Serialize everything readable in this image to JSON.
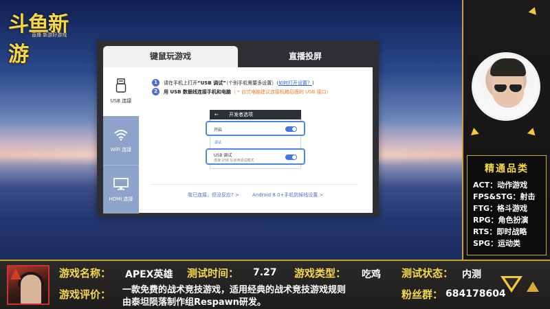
{
  "logo": {
    "title": "斗鱼新游",
    "subtitle": "直播 新游好游戏"
  },
  "dialog": {
    "tabs": [
      {
        "label": "键鼠玩游戏"
      },
      {
        "label": "直播投屏"
      }
    ],
    "sidebar": [
      {
        "label": "USB 连接",
        "icon": "usb-icon"
      },
      {
        "label": "WiFi 连接",
        "icon": "wifi-icon"
      },
      {
        "label": "HDMI 连接",
        "icon": "monitor-icon"
      }
    ],
    "steps": [
      {
        "num": "1",
        "text_before": "请在手机上打开",
        "text_bold": "“USB 调试”",
        "text_after": "（个别手机需要多设置）(",
        "link": "如何打开设置？",
        "text_end": ")"
      },
      {
        "num": "2",
        "text_bold": "用 USB 数据线连接手机和电脑",
        "note": "（ * 台式电脑建议连接机箱后面的 USB 接口）"
      }
    ],
    "phone": {
      "title": "开发者选项",
      "options": [
        {
          "title": "开启",
          "subtitle": ""
        },
        {
          "title": "USB 调试",
          "subtitle": "连接 USB 后启用调试模式"
        }
      ],
      "section": "调试"
    },
    "footer_links": [
      "我已连接，但没反应? >",
      "Android 8.0+手机防掉线设置 >"
    ]
  },
  "categories": {
    "title": "精通品类",
    "items": [
      "ACT：动作游戏",
      "FPS&STG：射击",
      "FTG：格斗游戏",
      "RPG：角色扮演",
      "RTS：即时战略",
      "SPG：运动类"
    ]
  },
  "info_bar": {
    "name_label": "游戏名称：",
    "name_value": "APEX英雄",
    "time_label": "测试时间：",
    "time_value": "7.27",
    "type_label": "游戏类型：",
    "type_value": "吃鸡",
    "status_label": "测试状态：",
    "status_value": "内测",
    "review_label": "游戏评价：",
    "review_line1": "一款免费的战术竞技游戏，适用经典的战术竞技游戏规则",
    "review_line2": "由泰坦陨落制作组Respawn研发。",
    "fans_label": "粉丝群：",
    "fans_value": "684178604"
  },
  "colors": {
    "accent_gold": "#f5d84c",
    "link_blue": "#2c64d8",
    "note_orange": "#f07a2b",
    "toggle_blue": "#3c7ae0"
  }
}
